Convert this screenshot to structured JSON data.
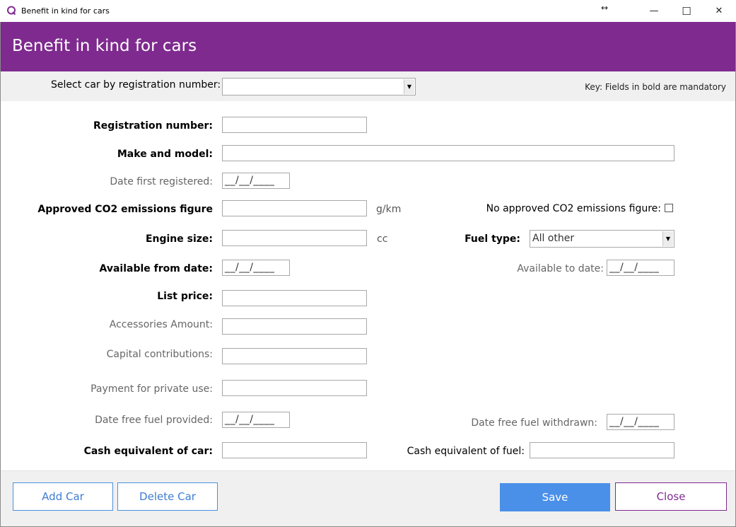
{
  "window": {
    "title": "Benefit in kind for cars",
    "minimize_glyph": "—",
    "maximize_glyph": "☐",
    "close_glyph": "✕",
    "resize_glyph": "↔"
  },
  "header": {
    "title": "Benefit in kind for cars"
  },
  "selector": {
    "label": "Select car by registration number:",
    "value": "",
    "key_text": "Key: Fields in bold are mandatory"
  },
  "form": {
    "registration_number": {
      "label": "Registration number:",
      "value": ""
    },
    "make_model": {
      "label": "Make and model:",
      "value": ""
    },
    "date_first_registered": {
      "label": "Date first registered:",
      "value": "__/__/____"
    },
    "co2": {
      "label": "Approved CO2 emissions figure",
      "value": "",
      "unit": "g/km"
    },
    "no_co2": {
      "label": "No approved CO2 emissions figure:",
      "checked": false
    },
    "engine_size": {
      "label": "Engine size:",
      "value": "",
      "unit": "cc"
    },
    "fuel_type": {
      "label": "Fuel type:",
      "value": "All other"
    },
    "available_from": {
      "label": "Available from date:",
      "value": "__/__/____"
    },
    "available_to": {
      "label": "Available to date:",
      "value": "__/__/____"
    },
    "list_price": {
      "label": "List price:",
      "value": ""
    },
    "accessories": {
      "label": "Accessories Amount:",
      "value": ""
    },
    "capital_contributions": {
      "label": "Capital contributions:",
      "value": ""
    },
    "private_use_payment": {
      "label": "Payment for private use:",
      "value": ""
    },
    "free_fuel_provided": {
      "label": "Date free fuel provided:",
      "value": "__/__/____"
    },
    "free_fuel_withdrawn": {
      "label": "Date free fuel withdrawn:",
      "value": "__/__/____"
    },
    "cash_equiv_car": {
      "label": "Cash equivalent of car:",
      "value": ""
    },
    "cash_equiv_fuel": {
      "label": "Cash equivalent of fuel:",
      "value": ""
    }
  },
  "buttons": {
    "add_car": "Add Car",
    "delete_car": "Delete Car",
    "save": "Save",
    "close": "Close"
  },
  "colors": {
    "brand_purple": "#7e2a8e",
    "save_blue": "#4b90e8"
  }
}
